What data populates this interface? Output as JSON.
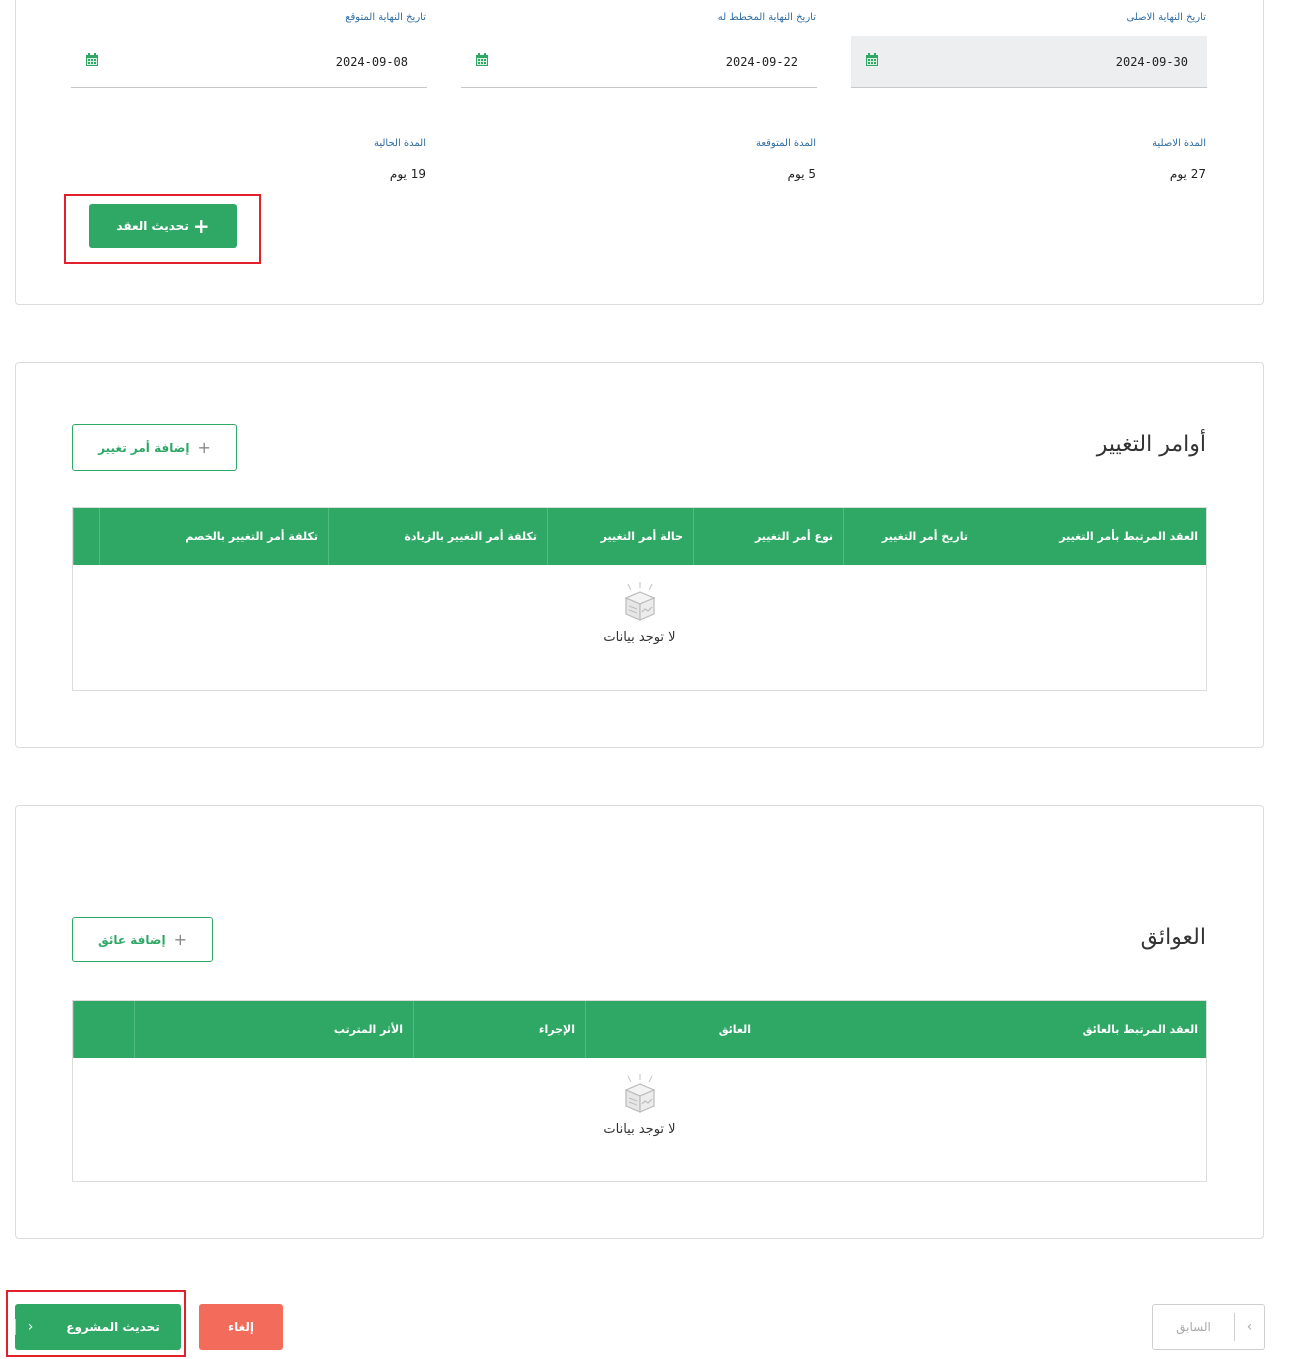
{
  "dates": {
    "original_end": {
      "label": "تاريخ النهاية الاصلى",
      "value": "2024-09-30"
    },
    "planned_end": {
      "label": "تاريخ النهاية المخطط له",
      "value": "2024-09-22"
    },
    "expected_end": {
      "label": "تاريخ النهاية المتوقع",
      "value": "2024-09-08"
    }
  },
  "durations": {
    "original": {
      "label": "المدة الاصلية",
      "value": "27 يوم"
    },
    "expected": {
      "label": "المدة المتوقعة",
      "value": "5 يوم"
    },
    "current": {
      "label": "المدة الحالية",
      "value": "19 يوم"
    }
  },
  "update_contract_button": {
    "icon": "plus-icon",
    "label": "تحديث العقد"
  },
  "change_orders": {
    "title": "أوامر التغيير",
    "add_button": "إضافة أمر تغيير",
    "columns": [
      "العقد المرتبط بأمر التغيير",
      "تاريخ أمر التغيير",
      "نوع أمر التغيير",
      "حالة أمر التغيير",
      "تكلفة أمر التغيير بالزيادة",
      "تكلفة أمر التغيير بالخصم"
    ],
    "empty_text": "لا توجد بيانات"
  },
  "obstacles": {
    "title": "العوائق",
    "add_button": "إضافة عائق",
    "columns": [
      "العقد المرتبط بالعائق",
      "العائق",
      "الإجراء",
      "الأثر المترتب"
    ],
    "empty_text": "لا توجد بيانات"
  },
  "footer": {
    "update_project": "تحديث المشروع",
    "cancel": "إلغاء",
    "previous": "السابق"
  },
  "colors": {
    "primary_green": "#2fa866",
    "label_blue": "#2e6da4",
    "cancel_red": "#f26b5b",
    "highlight_red": "#e0202a"
  }
}
